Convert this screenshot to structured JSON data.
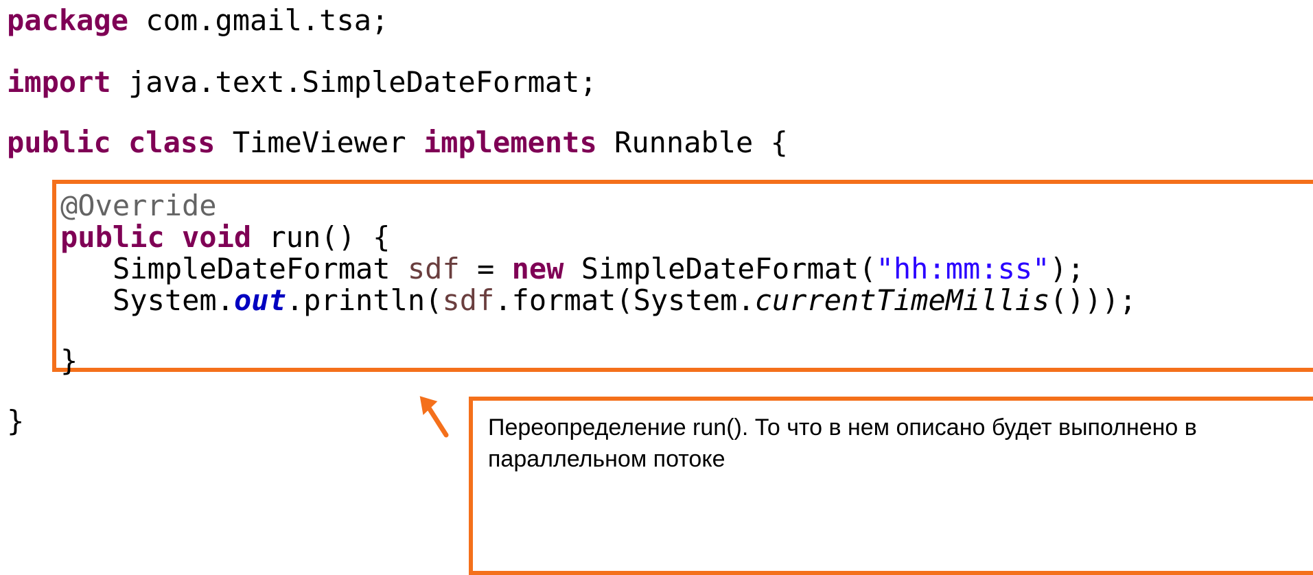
{
  "code": {
    "line1": {
      "kw": "package",
      "rest": " com.gmail.tsa;"
    },
    "line2": {
      "kw": "import",
      "rest": " java.text.SimpleDateFormat;"
    },
    "line3": {
      "kw1": "public",
      "sp1": " ",
      "kw2": "class",
      "name": " TimeViewer ",
      "kw3": "implements",
      "rest": " Runnable {"
    },
    "line4": {
      "annotation": "@Override"
    },
    "line5": {
      "kw1": "public",
      "sp1": " ",
      "kw2": "void",
      "rest": " run() {"
    },
    "line6": {
      "type": "SimpleDateFormat ",
      "var": "sdf",
      "eq": " = ",
      "kw": "new",
      "ctor": " SimpleDateFormat(",
      "str": "\"hh:mm:ss\"",
      "end": ");"
    },
    "line7": {
      "sys": "System.",
      "field": "out",
      "call": ".println(",
      "var": "sdf",
      "fmt": ".format(System.",
      "method": "currentTimeMillis",
      "end": "()));"
    },
    "line8": {
      "text": "}"
    },
    "line9": {
      "text": "}"
    }
  },
  "note": {
    "text": "Переопределение run(). То что в нем описано будет выполнено в параллельном потоке"
  },
  "colors": {
    "accent": "#f4701b",
    "keyword": "#7f0055",
    "string": "#2a00ff",
    "field": "#0000c0",
    "variable": "#6a3e3e",
    "annotation": "#646464"
  },
  "icons": {
    "pointer": "arrow-icon"
  }
}
